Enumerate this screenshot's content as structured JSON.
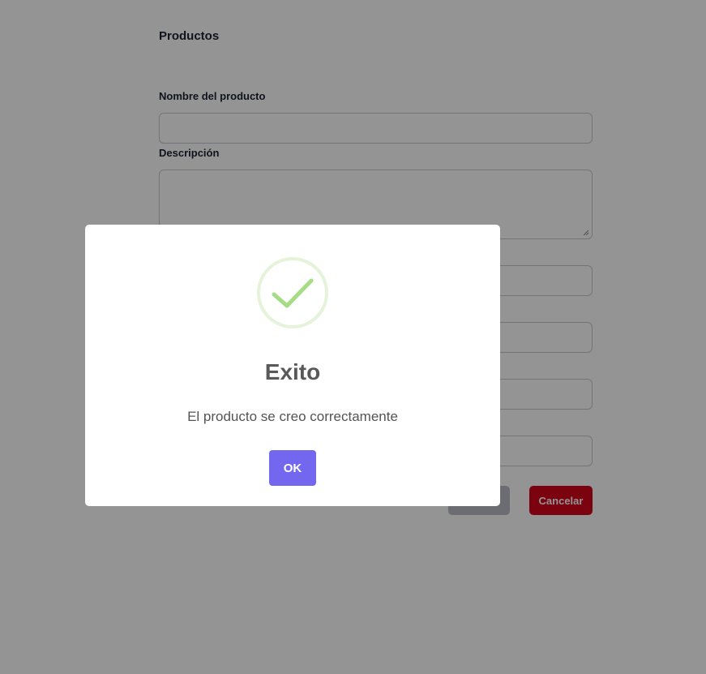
{
  "page": {
    "title": "Productos",
    "form": {
      "name_label": "Nombre del producto",
      "name_value": "",
      "description_label": "Descripción",
      "description_value": "",
      "field3_value": "",
      "field4_value": "",
      "field5_value": "",
      "field6_value": "",
      "save_label": "",
      "cancel_label": "Cancelar"
    }
  },
  "modal": {
    "icon": "check-circle-icon",
    "title": "Exito",
    "text": "El producto se creo correctamente",
    "confirm_label": "OK"
  },
  "colors": {
    "backdrop": "rgba(0,0,0,0.42)",
    "confirm_button": "#7367f0",
    "cancel_button": "#d4061a",
    "success_icon": "#a5dc86"
  }
}
